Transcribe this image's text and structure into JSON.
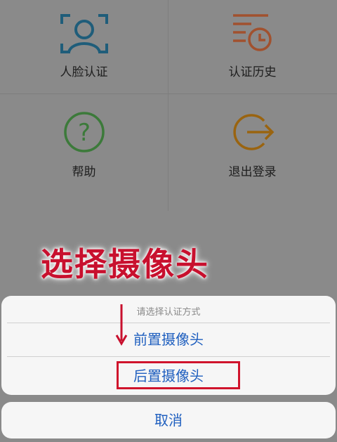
{
  "menu": {
    "face_auth": "人脸认证",
    "auth_history": "认证历史",
    "help": "帮助",
    "logout": "退出登录"
  },
  "overlay": {
    "title": "选择摄像头"
  },
  "action_sheet": {
    "title": "请选择认证方式",
    "options": [
      "前置摄像头",
      "后置摄像头"
    ],
    "cancel": "取消"
  },
  "colors": {
    "face_icon": "#1f5d7a",
    "history_icon": "#a1512e",
    "help_icon": "#3c7a3a",
    "logout_icon": "#9a6410",
    "annotation": "#c8102e",
    "option_text": "#1f5fbf"
  }
}
